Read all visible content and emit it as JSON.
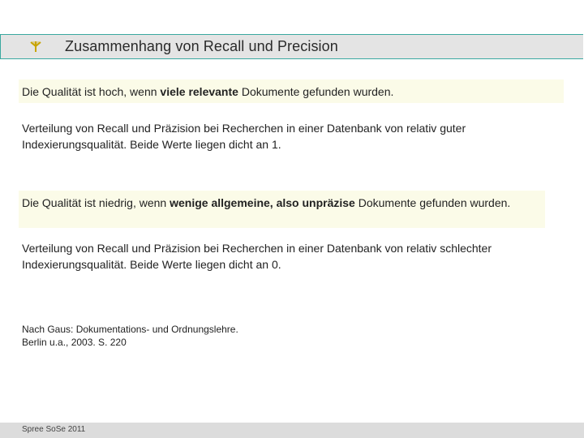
{
  "slide": {
    "title": "Zusammenhang von Recall und Precision",
    "title_icon": "checkmark-arrow-icon",
    "box1": {
      "before": "Die Qualität ist hoch, wenn ",
      "bold": "viele relevante",
      "after": " Dokumente gefunden wurden."
    },
    "para1": "Verteilung von Recall und Präzision bei Recherchen in einer Datenbank von relativ guter Indexierungsqualität. Beide Werte liegen dicht an 1.",
    "box2": {
      "before": "Die Qualität ist niedrig, wenn ",
      "bold": "wenige allgemeine, also unpräzise",
      "after": " Dokumente gefunden wurden."
    },
    "para2": "Verteilung von Recall und Präzision bei Recherchen in einer Datenbank von relativ schlechter Indexierungsqualität. Beide Werte liegen dicht an 0.",
    "source_line1": "Nach Gaus: Dokumentations- und Ordnungslehre.",
    "source_line2": "Berlin u.a., 2003. S. 220",
    "footer": "Spree SoSe 2011"
  },
  "colors": {
    "title_border": "#3aa8a0",
    "title_bg": "#e4e4e4",
    "icon": "#c8a400",
    "highlight_bg": "#fbfbe8",
    "footer_bg": "#dcdcdc"
  }
}
